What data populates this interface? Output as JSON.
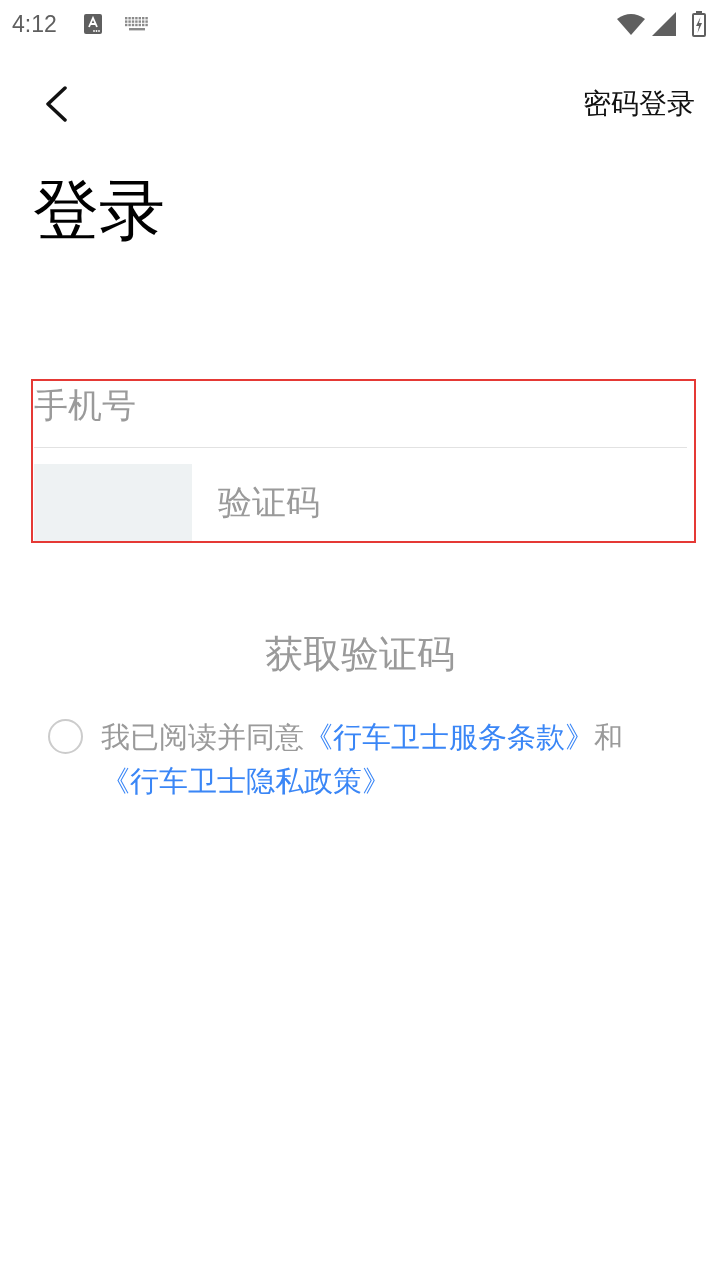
{
  "status_bar": {
    "time": "4:12"
  },
  "header": {
    "right_action": "密码登录"
  },
  "title": "登录",
  "form": {
    "highlighted": true,
    "phone": {
      "placeholder": "手机号"
    },
    "captcha": {
      "placeholder": "验证码"
    }
  },
  "get_code_button": {
    "label": "获取验证码",
    "disabled": true
  },
  "agreement": {
    "checked": false,
    "parts": [
      {
        "kind": "text",
        "text": "我已阅读并同意"
      },
      {
        "kind": "link",
        "text": "《行车卫士服务条款》"
      },
      {
        "kind": "text",
        "text": "和"
      },
      {
        "kind": "link",
        "text": "《行车卫士隐私政策》"
      }
    ]
  }
}
